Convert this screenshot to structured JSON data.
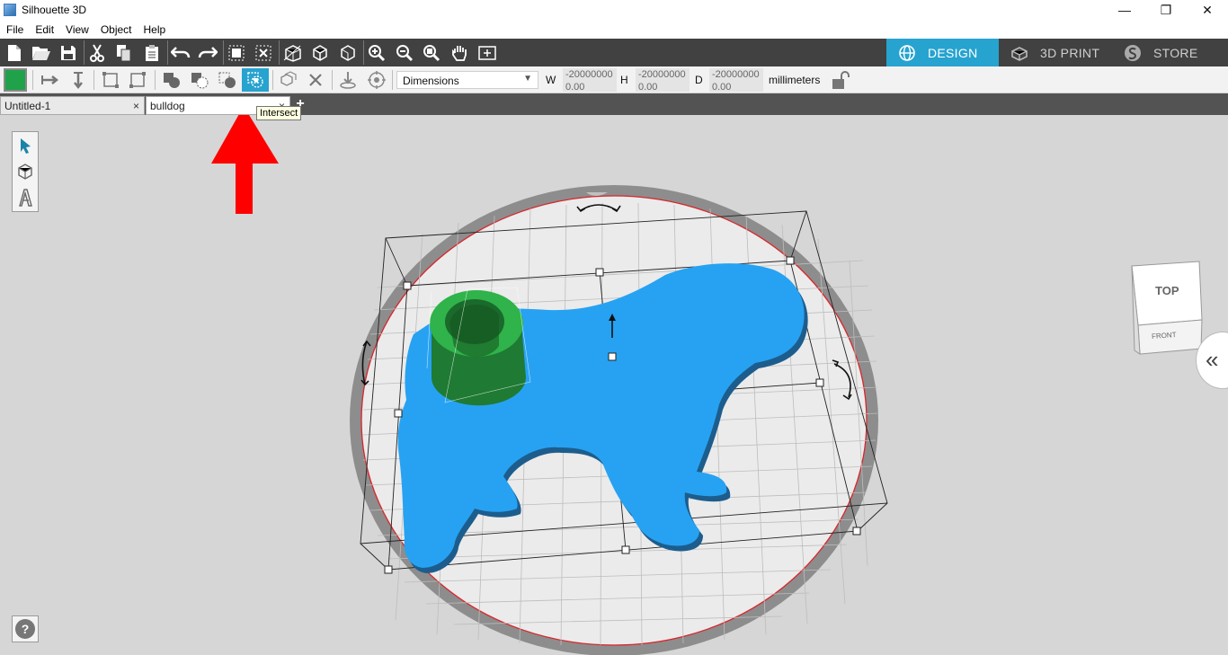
{
  "window": {
    "title": "Silhouette 3D",
    "minimize": "—",
    "maximize": "❐",
    "close": "✕"
  },
  "menu": [
    "File",
    "Edit",
    "View",
    "Object",
    "Help"
  ],
  "modes": [
    {
      "label": "DESIGN",
      "active": true
    },
    {
      "label": "3D PRINT",
      "active": false
    },
    {
      "label": "STORE",
      "active": false
    }
  ],
  "dimensions": {
    "select_value": "Dimensions",
    "w_label": "W",
    "w_top": "-20000000",
    "w_value": "0.00",
    "h_label": "H",
    "h_top": "-20000000",
    "h_value": "0.00",
    "d_label": "D",
    "d_top": "-20000000",
    "d_value": "0.00",
    "units": "millimeters"
  },
  "tabs": [
    {
      "label": "Untitled-1",
      "close": "×"
    },
    {
      "label": "bulldog",
      "close": "×"
    }
  ],
  "add_tab": "+",
  "tooltip": "Intersect",
  "viewcube": {
    "top": "TOP",
    "front": "FRONT"
  },
  "help": "?",
  "collapse": "«",
  "colors": {
    "accent": "#27a3cf",
    "dog": "#27a2f2",
    "cylinder": "#2fb34a",
    "arrow": "#ff0000",
    "toolbar_dark": "#414141"
  },
  "toolbar_icons": [
    "new-icon",
    "open-icon",
    "save-icon",
    "cut-icon",
    "copy-icon",
    "paste-icon",
    "undo-icon",
    "redo-icon",
    "group-icon",
    "ungroup-icon",
    "view-3d-icon",
    "box-icon",
    "box-outline-icon",
    "zoom-in-icon",
    "zoom-out-icon",
    "zoom-fit-icon",
    "pan-icon",
    "frame-icon"
  ]
}
